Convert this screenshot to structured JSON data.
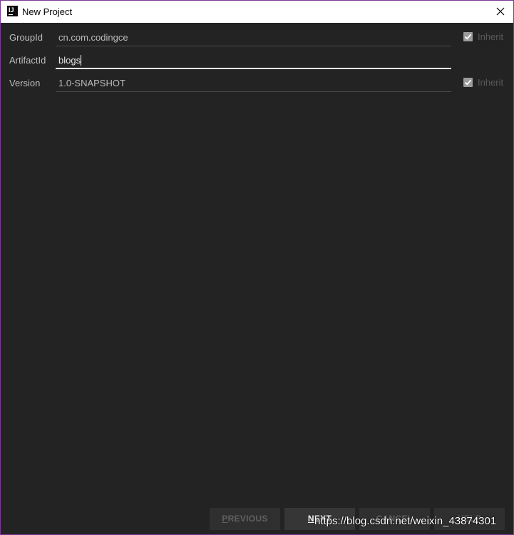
{
  "window": {
    "title": "New Project",
    "app_icon_text": "IJ"
  },
  "form": {
    "group_id": {
      "label": "GroupId",
      "value": "cn.com.codingce",
      "inherit_label": "Inherit",
      "inherit_checked": true
    },
    "artifact_id": {
      "label": "ArtifactId",
      "value": "blogs"
    },
    "version": {
      "label": "Version",
      "value": "1.0-SNAPSHOT",
      "inherit_label": "Inherit",
      "inherit_checked": true
    }
  },
  "buttons": {
    "previous": {
      "mnemonic": "P",
      "rest": "REVIOUS"
    },
    "next": {
      "mnemonic": "N",
      "rest": "EXT"
    },
    "cancel": {
      "label": "CANCEL"
    },
    "help": {
      "label": "HELP"
    }
  },
  "watermark": "https://blog.csdn.net/weixin_43874301",
  "colors": {
    "background": "#232323",
    "window_border": "#7a3b8f",
    "active_field_underline": "#e8e8e8"
  }
}
